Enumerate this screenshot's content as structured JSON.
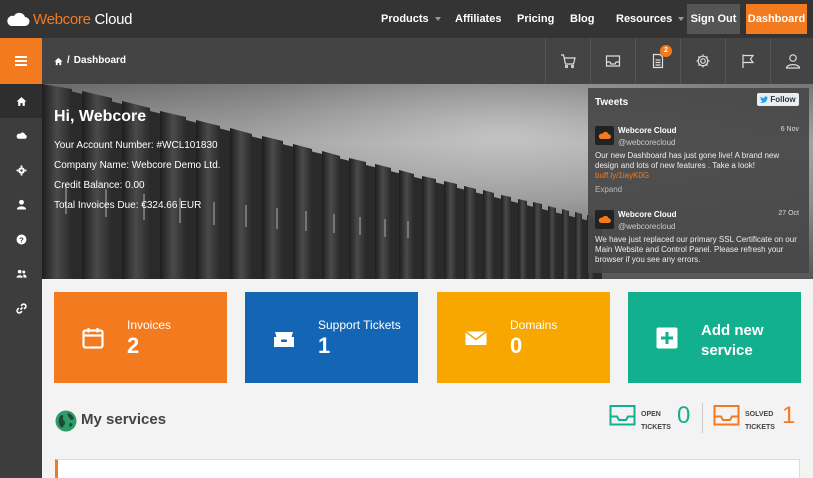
{
  "brand": {
    "name_part1": "Webcore",
    "name_part2": " Cloud",
    "accent": "#f47a1f"
  },
  "nav": {
    "products": "Products",
    "affiliates": "Affiliates",
    "pricing": "Pricing",
    "blog": "Blog",
    "resources": "Resources",
    "sign_out": "Sign Out",
    "dashboard": "Dashboard"
  },
  "breadcrumb": {
    "separator": "/",
    "current": "Dashboard"
  },
  "notifications": {
    "count": "2"
  },
  "hero": {
    "greeting": "Hi, Webcore",
    "account_number": "Your Account Number: #WCL101830",
    "company_name": "Company Name: Webcore Demo Ltd.",
    "credit_balance": "Credit Balance: 0.00",
    "total_invoices_due": "Total Invoices Due: €324.66 EUR"
  },
  "tweets": {
    "heading": "Tweets",
    "follow_label": "Follow",
    "items": [
      {
        "name": "Webcore Cloud",
        "handle": "@webcorecloud",
        "date": "6 Nov",
        "text": "Our new Dashboard has just gone live! A brand new design and lots of new features . Take a look!",
        "link": "buff.ly/1iayK0G",
        "expand": "Expand"
      },
      {
        "name": "Webcore Cloud",
        "handle": "@webcorecloud",
        "date": "27 Oct",
        "text": "We have just replaced our primary SSL Certificate on our Main Website and Control Panel. Please refresh your browser if you see any errors."
      }
    ]
  },
  "tiles": {
    "invoices": {
      "label": "Invoices",
      "value": "2",
      "color": "#f47a1f"
    },
    "support": {
      "label": "Support Tickets",
      "value": "1",
      "color": "#1565b5"
    },
    "domains": {
      "label": "Domains",
      "value": "0",
      "color": "#f7a700"
    },
    "add": {
      "line1": "Add new",
      "line2": "service",
      "color": "#12b08e"
    }
  },
  "services": {
    "title": "My services",
    "open_label_1": "OPEN",
    "open_label_2": "TICKETS",
    "open_count": "0",
    "solved_label_1": "SOLVED",
    "solved_label_2": "TICKETS",
    "solved_count": "1"
  },
  "icons": {
    "sidebar": [
      "home-icon",
      "cloud-icon",
      "gear-icon",
      "user-icon",
      "help-icon",
      "users-icon",
      "link-icon"
    ],
    "toolbar": [
      "cart-icon",
      "inbox-icon",
      "document-icon",
      "settings-icon",
      "flag-icon",
      "profile-icon"
    ]
  }
}
